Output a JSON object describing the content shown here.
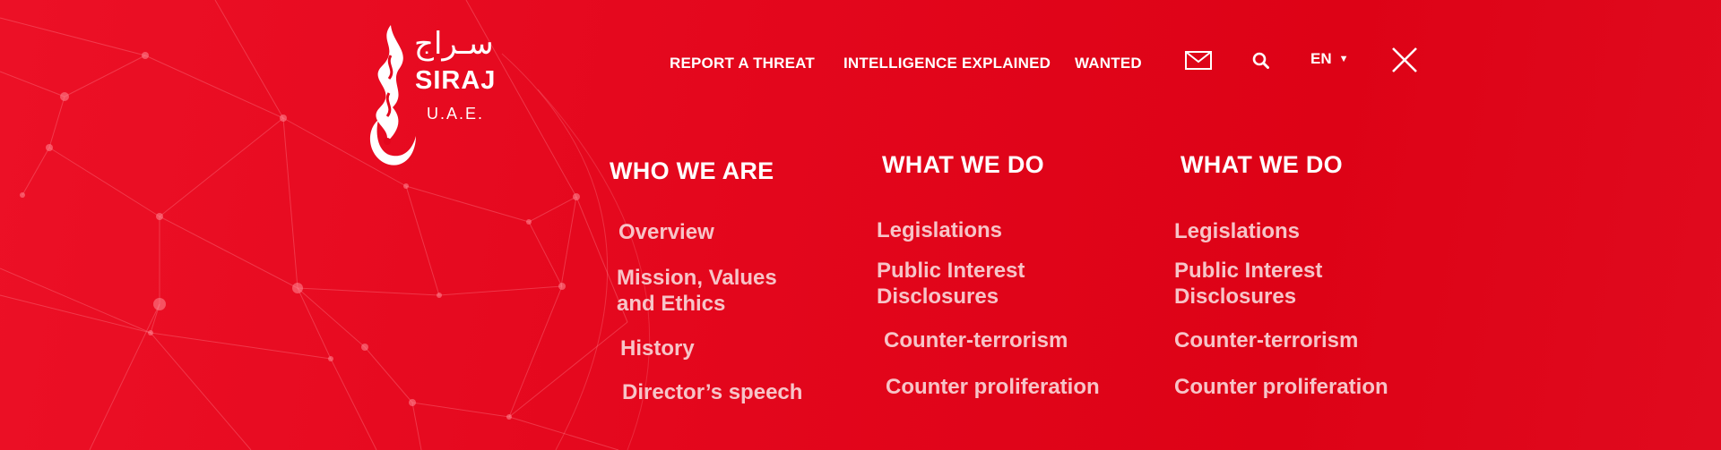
{
  "logo": {
    "arabic": "سـراج",
    "name": "SIRAJ",
    "country": "U.A.E."
  },
  "nav": {
    "items": [
      {
        "label": "REPORT A THREAT"
      },
      {
        "label": "INTELLIGENCE EXPLAINED"
      },
      {
        "label": "WANTED"
      }
    ],
    "language": "EN",
    "icons": [
      "mail-icon",
      "search-icon",
      "close-icon"
    ]
  },
  "menu": {
    "columns": [
      {
        "heading": "WHO WE ARE",
        "links": [
          "Overview",
          "Mission, Values and Ethics",
          "History",
          "Director’s speech"
        ]
      },
      {
        "heading": "WHAT WE DO",
        "links": [
          "Legislations",
          "Public Interest Disclosures",
          "Counter-terrorism",
          "Counter proliferation"
        ]
      },
      {
        "heading": "WHAT WE DO",
        "links": [
          "Legislations",
          "Public Interest Disclosures",
          "Counter-terrorism",
          "Counter proliferation"
        ]
      }
    ]
  },
  "colors": {
    "background": "#e3061c",
    "text": "#ffffff",
    "link": "#f7c4c8"
  }
}
